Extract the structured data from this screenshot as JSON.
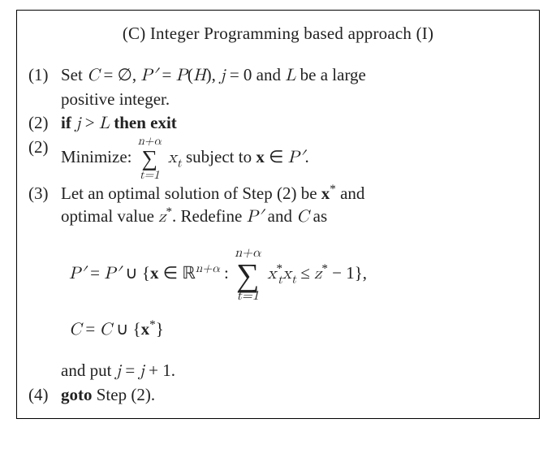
{
  "title": "(C) Integer Programming based approach (I)",
  "steps": {
    "s1": {
      "num": "(1)",
      "body": "Set C = ∅, P′ = P(H), j = 0 and L be a large positive integer."
    },
    "s2": {
      "num": "(2)",
      "pre": "if ",
      "cond": "j > L",
      "then": " then exit"
    },
    "s3": {
      "num": "(2)",
      "pre": "Minimize: ",
      "sum_top": "n+α",
      "sum_bot": "t=1",
      "sumexpr": " x",
      "sub_t": "t",
      "post": " subject to ",
      "xin": "x ∈ P′."
    },
    "s4": {
      "num": "(3)",
      "body": "Let an optimal solution of Step (2) be x* and optimal value z*. Redefine P′ and C as"
    },
    "eq1": {
      "lhs": "P′ = P′ ∪ {x ∈ ",
      "rn": "ℝ",
      "sup": "n+α",
      "mid": " : ",
      "sum_top": "n+α",
      "sum_bot": "t=1",
      "xt": "x",
      "sub_t": "t",
      "star": "*",
      "xt2": "x",
      "sub_t2": "t",
      "rhs": " ≤ z* − 1},"
    },
    "eq2": {
      "text": "C = C ∪ {x*}"
    },
    "s5": {
      "body": "and put j = j + 1."
    },
    "s6": {
      "num": "(4)",
      "pre": "goto ",
      "post": "Step (2)."
    }
  }
}
